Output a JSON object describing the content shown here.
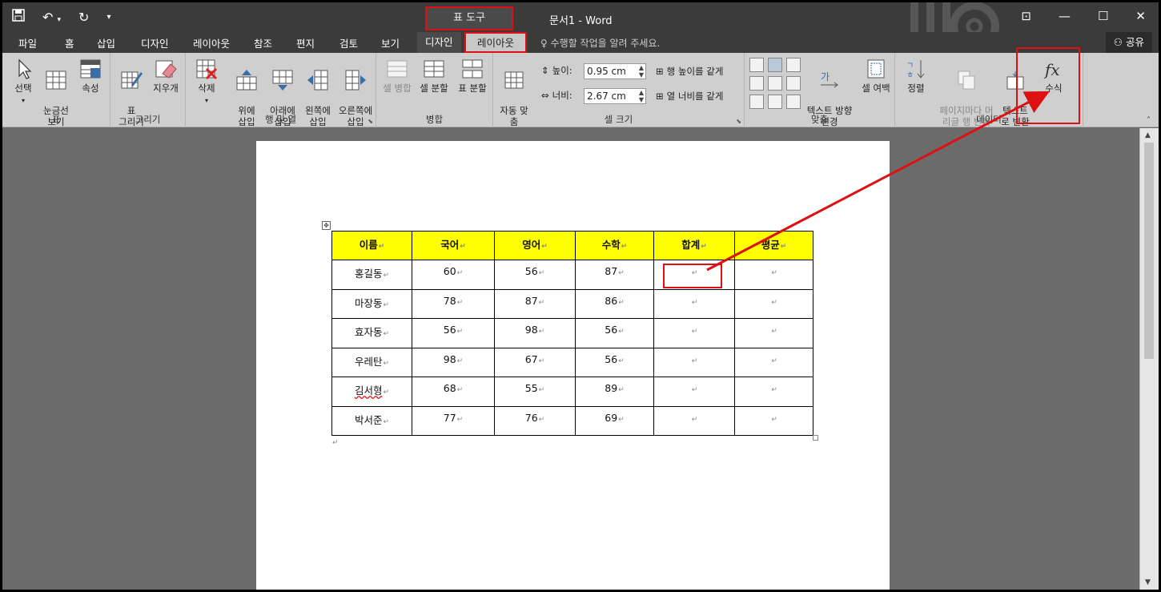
{
  "title_bar": {
    "context_tab_group": "표 도구",
    "document_title": "문서1 - Word"
  },
  "tabs": [
    "파일",
    "홈",
    "삽입",
    "디자인",
    "레이아웃",
    "참조",
    "편지",
    "검토",
    "보기"
  ],
  "context_tabs": {
    "design": "디자인",
    "layout": "레이아웃"
  },
  "tell_me": "수행할 작업을 알려 주세요.",
  "share": "공유",
  "ribbon": {
    "table_group": {
      "label": "표",
      "select": "선택",
      "gridlines": "눈금선\n보기",
      "properties": "속성"
    },
    "draw_group": {
      "label": "그리기",
      "draw_table": "표\n그리기",
      "eraser": "지우개"
    },
    "rows_cols_group": {
      "label": "행 및 열",
      "delete": "삭제",
      "insert_above": "위에\n삽입",
      "insert_below": "아래에\n삽입",
      "insert_left": "왼쪽에\n삽입",
      "insert_right": "오른쪽에\n삽입"
    },
    "merge_group": {
      "label": "병합",
      "merge_cells": "셀 병합",
      "split_cells": "셀 분할",
      "split_table": "표 분할"
    },
    "cell_size_group": {
      "label": "셀 크기",
      "autofit": "자동 맞\n춤",
      "height_label": "높이:",
      "height_value": "0.95 cm",
      "width_label": "너비:",
      "width_value": "2.67 cm",
      "distribute_rows": "행 높이를 같게",
      "distribute_cols": "열 너비를 같게"
    },
    "alignment_group": {
      "label": "맞춤",
      "text_direction": "텍스트 방향\n변경",
      "cell_margins": "셀 여백"
    },
    "data_group": {
      "label": "데이터",
      "sort": "정렬",
      "repeat_header": "페이지마다 머\n리글 행 반복",
      "convert_text": "텍스트\n로 변환",
      "formula": "수식"
    }
  },
  "table": {
    "headers": [
      "이름",
      "국어",
      "영어",
      "수학",
      "합계",
      "평균"
    ],
    "rows": [
      [
        "홍길동",
        "60",
        "56",
        "87",
        "",
        ""
      ],
      [
        "마장동",
        "78",
        "87",
        "86",
        "",
        ""
      ],
      [
        "효자동",
        "56",
        "98",
        "56",
        "",
        ""
      ],
      [
        "우레탄",
        "98",
        "67",
        "56",
        "",
        ""
      ],
      [
        "김서형",
        "68",
        "55",
        "89",
        "",
        ""
      ],
      [
        "박서준",
        "77",
        "76",
        "69",
        "",
        ""
      ]
    ],
    "header_color": "#ffff00"
  },
  "colors": {
    "highlight": "#dd1111",
    "titlebar": "#3b3b3b",
    "ribbon": "#cfcfcf"
  }
}
